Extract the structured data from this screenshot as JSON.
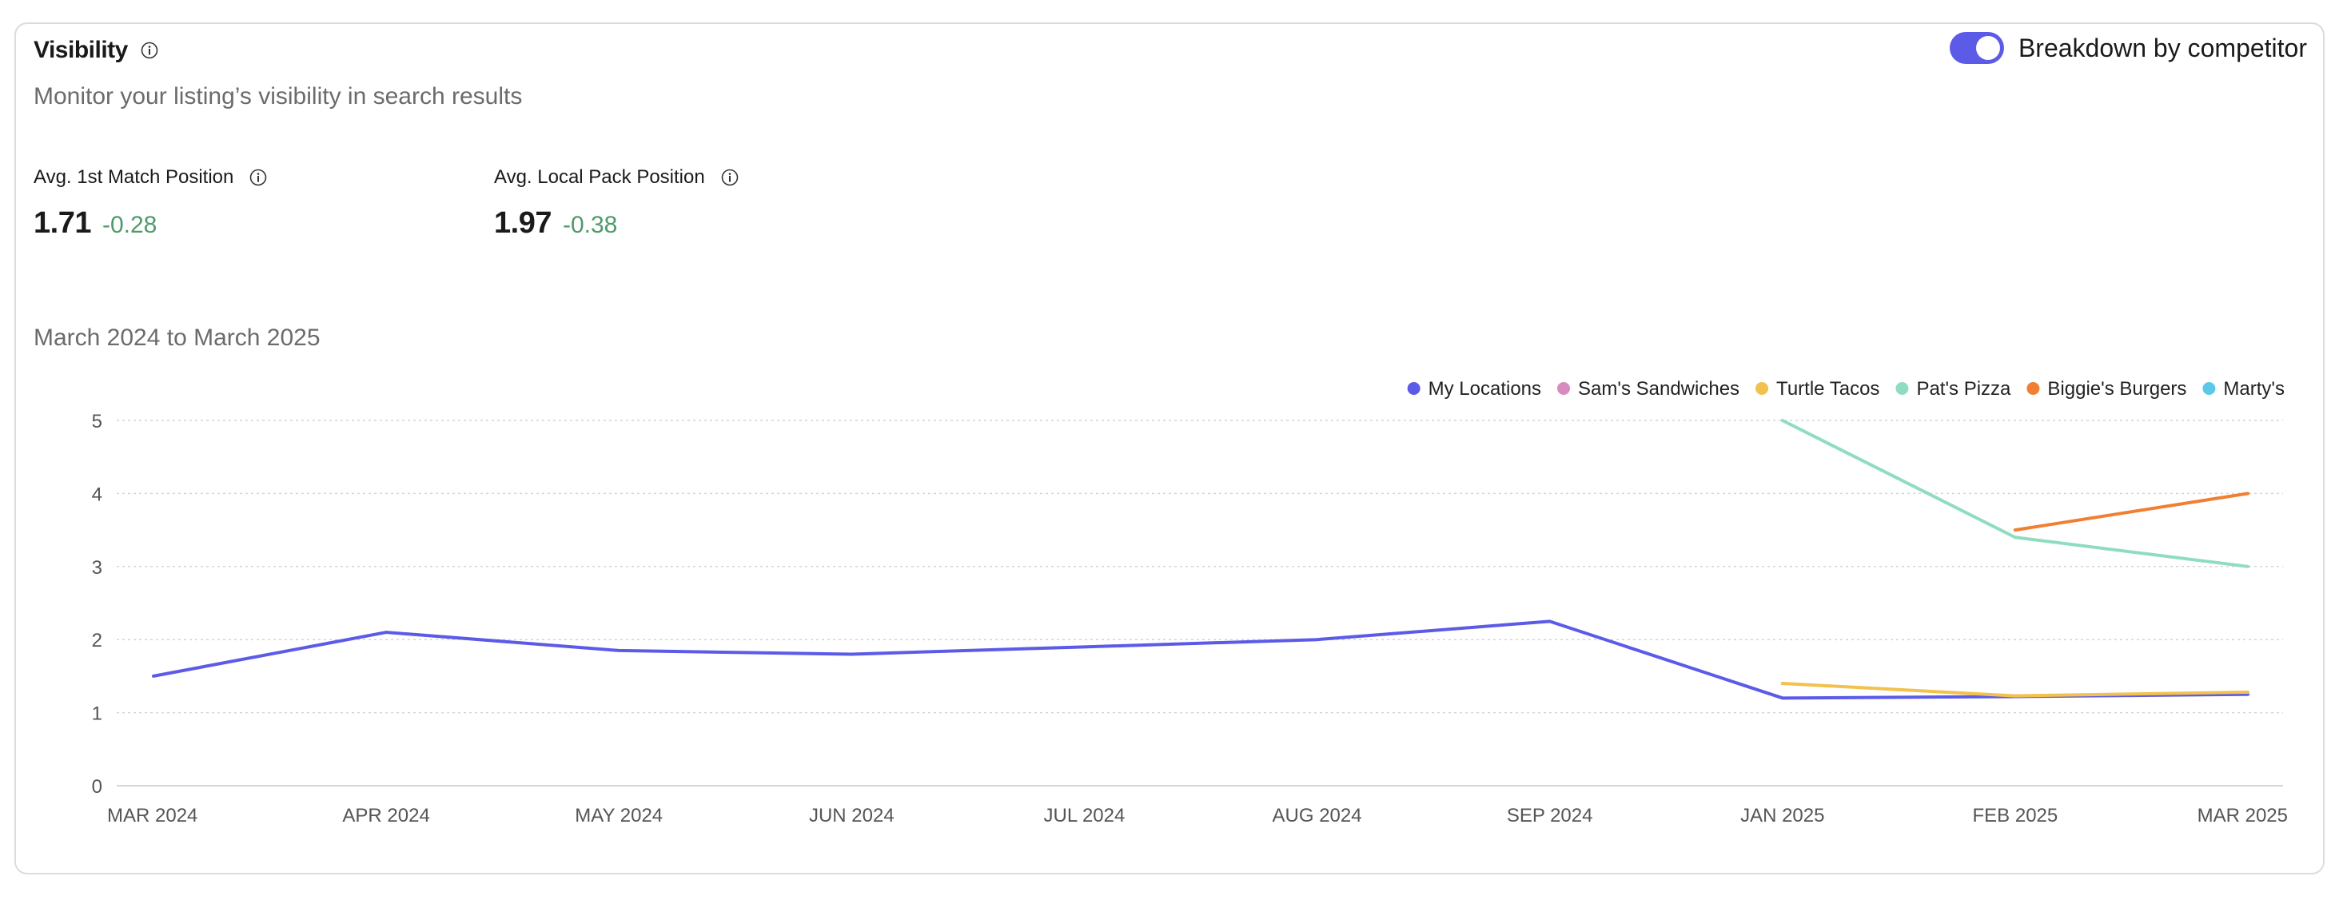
{
  "header": {
    "title": "Visibility",
    "subtitle": "Monitor your listing’s visibility in search results",
    "toggle_label": "Breakdown by competitor",
    "toggle_on": true
  },
  "metrics": [
    {
      "label": "Avg. 1st Match Position",
      "value": "1.71",
      "delta": "-0.28"
    },
    {
      "label": "Avg. Local Pack Position",
      "value": "1.97",
      "delta": "-0.38"
    }
  ],
  "colors": {
    "accent": "#5b5be8",
    "delta_positive": "#4e9a6b"
  },
  "chart_data": {
    "type": "line",
    "title": "March 2024 to March 2025",
    "xlabel": "",
    "ylabel": "",
    "categories": [
      "MAR 2024",
      "APR 2024",
      "MAY 2024",
      "JUN 2024",
      "JUL 2024",
      "AUG 2024",
      "SEP 2024",
      "JAN 2025",
      "FEB 2025",
      "MAR 2025"
    ],
    "ylim": [
      0,
      5
    ],
    "yticks": [
      0,
      1,
      2,
      3,
      4,
      5
    ],
    "grid": true,
    "legend_position": "top-right",
    "series": [
      {
        "name": "My Locations",
        "color": "#5b5be8",
        "values": [
          1.5,
          2.1,
          1.85,
          1.8,
          1.9,
          2.0,
          2.25,
          1.2,
          1.22,
          1.25
        ]
      },
      {
        "name": "Sam's Sandwiches",
        "color": "#d98bbf",
        "values": [
          null,
          null,
          null,
          null,
          null,
          null,
          null,
          null,
          null,
          null
        ]
      },
      {
        "name": "Turtle Tacos",
        "color": "#f2c14e",
        "values": [
          null,
          null,
          null,
          null,
          null,
          null,
          null,
          1.4,
          1.23,
          1.28
        ]
      },
      {
        "name": "Pat's Pizza",
        "color": "#8fdcc0",
        "values": [
          null,
          null,
          null,
          null,
          null,
          null,
          null,
          5.0,
          3.4,
          3.0
        ]
      },
      {
        "name": "Biggie's Burgers",
        "color": "#f07f34",
        "values": [
          null,
          null,
          null,
          null,
          null,
          null,
          null,
          null,
          3.5,
          4.0
        ]
      },
      {
        "name": "Marty's",
        "color": "#5bc8e8",
        "values": [
          null,
          null,
          null,
          null,
          null,
          null,
          null,
          null,
          null,
          null
        ]
      }
    ]
  }
}
